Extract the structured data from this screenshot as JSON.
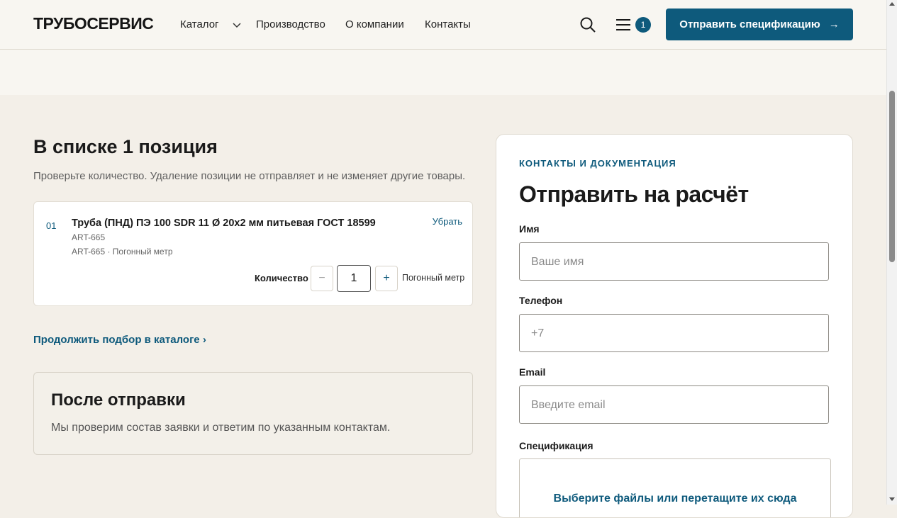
{
  "header": {
    "logo": "ТРУБОСЕРВИС",
    "nav": [
      "Каталог",
      "Производство",
      "О компании",
      "Контакты"
    ],
    "cart_count": "1",
    "cta_label": "Отправить спецификацию",
    "cta_arrow": "→"
  },
  "cart": {
    "title": "В списке 1 позиция",
    "subtitle": "Проверьте количество. Удаление позиции не отправляет и не изменяет другие товары.",
    "item": {
      "index": "01",
      "name": "Труба (ПНД) ПЭ 100 SDR 11 Ø 20x2 мм питьевая ГОСТ 18599",
      "sku": "ART-665",
      "sku_unit": "ART-665 · Погонный метр",
      "remove": "Убрать",
      "qty_label": "Количество",
      "qty_minus": "−",
      "qty_value": "1",
      "qty_plus": "+",
      "unit": "Погонный метр"
    },
    "continue_link": "Продолжить подбор в каталоге ›",
    "after": {
      "title": "После отправки",
      "text": "Мы проверим состав заявки и ответим по указанным контактам."
    }
  },
  "form": {
    "eyebrow": "КОНТАКТЫ И ДОКУМЕНТАЦИЯ",
    "title": "Отправить на расчёт",
    "name_label": "Имя",
    "name_placeholder": "Ваше имя",
    "phone_label": "Телефон",
    "phone_placeholder": "+7",
    "email_label": "Email",
    "email_placeholder": "Введите email",
    "spec_label": "Спецификация",
    "upload_text": "Выберите файлы или перетащите их сюда"
  },
  "colors": {
    "accent": "#0e5a7c",
    "page_bg": "#f3efe8",
    "header_bg": "#f8f6f1"
  }
}
